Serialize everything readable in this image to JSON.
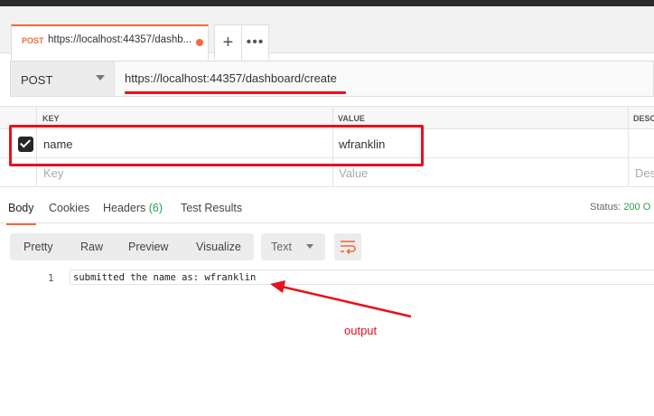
{
  "tab": {
    "method": "POST",
    "url": "https://localhost:44357/dashb..."
  },
  "icons": {
    "add": "plus-icon",
    "more": "more-dots-icon",
    "wrap": "wrap-lines-icon"
  },
  "request": {
    "method": "POST",
    "url": "https://localhost:44357/dashboard/create"
  },
  "params": {
    "headers": {
      "key": "KEY",
      "value": "VALUE",
      "description": "DESCRI"
    },
    "rows": [
      {
        "checked": true,
        "key": "name",
        "value": "wfranklin",
        "description": ""
      }
    ],
    "empty_row": {
      "key": "Key",
      "value": "Value",
      "description": "Des"
    }
  },
  "response_tabs": {
    "body": "Body",
    "cookies": "Cookies",
    "headers": "Headers",
    "headers_count": "(6)",
    "test_results": "Test Results"
  },
  "status": {
    "label": "Status:",
    "value": "200 O"
  },
  "body_view": {
    "modes": [
      "Pretty",
      "Raw",
      "Preview",
      "Visualize"
    ],
    "format": "Text"
  },
  "response_body": {
    "line_number": "1",
    "text": "submitted the name as: wfranklin"
  },
  "annotation": {
    "label": "output",
    "color": "#e8101a"
  }
}
